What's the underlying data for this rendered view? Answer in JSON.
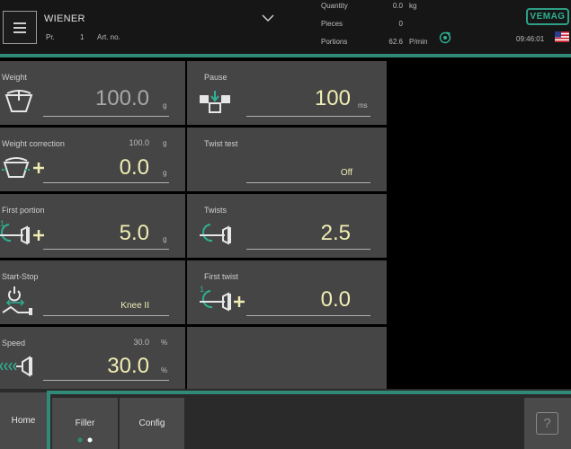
{
  "header": {
    "product_name": "WIENER",
    "program_label": "Pr.",
    "program_no": "1",
    "article_label": "Art. no.",
    "quantity_label": "Quantity",
    "quantity_value": "0.0",
    "quantity_unit": "kg",
    "pieces_label": "Pieces",
    "pieces_value": "0",
    "portions_label": "Portions",
    "portions_value": "62.6",
    "portions_unit": "P/min",
    "brand": "VEMAG",
    "time": "09:46:01"
  },
  "params": {
    "weight": {
      "label": "Weight",
      "value": "100.0",
      "unit": "g"
    },
    "pause": {
      "label": "Pause",
      "value": "100",
      "unit": "ms"
    },
    "weight_correction": {
      "label": "Weight correction",
      "set_value": "100.0",
      "set_unit": "g",
      "value": "0.0",
      "unit": "g"
    },
    "twist_test": {
      "label": "Twist test",
      "value": "Off"
    },
    "first_portion": {
      "label": "First portion",
      "value": "5.0",
      "unit": "g"
    },
    "twists": {
      "label": "Twists",
      "value": "2.5"
    },
    "start_stop": {
      "label": "Start-Stop",
      "value": "Knee II"
    },
    "first_twist": {
      "label": "First twist",
      "value": "0.0"
    },
    "speed": {
      "label": "Speed",
      "set_value": "30.0",
      "set_unit": "%",
      "value": "30.0",
      "unit": "%"
    }
  },
  "nav": {
    "home": "Home",
    "filler": "Filler",
    "config": "Config",
    "help": "?"
  },
  "colors": {
    "accent": "#2f8a77",
    "value": "#f0edb4",
    "panel": "#454545"
  }
}
